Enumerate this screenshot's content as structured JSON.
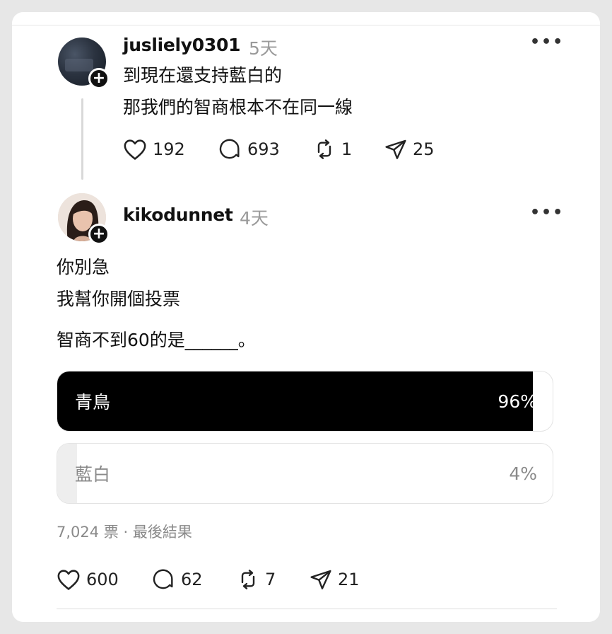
{
  "post1": {
    "username": "jusliely0301",
    "time": "5天",
    "lines": [
      "到現在還支持藍白的",
      "那我們的智商根本不在同一線"
    ],
    "likes": "192",
    "comments": "693",
    "reposts": "1",
    "shares": "25"
  },
  "post2": {
    "username": "kikodunnet",
    "time": "4天",
    "lines": [
      "你別急",
      "我幫你開個投票",
      "智商不到60的是______。"
    ],
    "poll": {
      "options": [
        {
          "label": "青鳥",
          "percent_text": "96%",
          "percent": 96,
          "selected": true
        },
        {
          "label": "藍白",
          "percent_text": "4%",
          "percent": 4,
          "selected": false
        }
      ],
      "votes_text": "7,024 票 · 最後結果"
    },
    "likes": "600",
    "comments": "62",
    "reposts": "7",
    "shares": "21"
  },
  "icons": [
    "more-icon",
    "heart-icon",
    "comment-icon",
    "repost-icon",
    "share-icon",
    "follow-plus-icon"
  ],
  "colors": {
    "poll_selected": "#000000",
    "poll_unselected": "#eeeeee",
    "muted_text": "#9a9a9a"
  }
}
